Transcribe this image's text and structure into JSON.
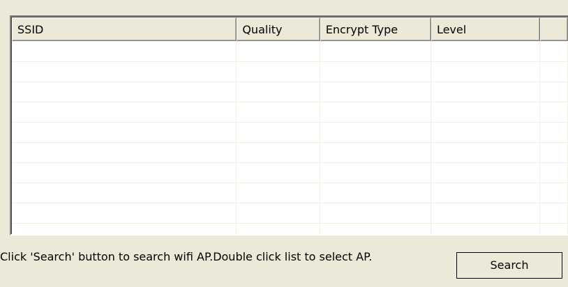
{
  "wifi_list": {
    "columns": [
      "SSID",
      "Quality",
      "Encrypt Type",
      "Level",
      ""
    ],
    "rows": [
      [
        "",
        "",
        "",
        "",
        ""
      ],
      [
        "",
        "",
        "",
        "",
        ""
      ],
      [
        "",
        "",
        "",
        "",
        ""
      ],
      [
        "",
        "",
        "",
        "",
        ""
      ],
      [
        "",
        "",
        "",
        "",
        ""
      ],
      [
        "",
        "",
        "",
        "",
        ""
      ],
      [
        "",
        "",
        "",
        "",
        ""
      ],
      [
        "",
        "",
        "",
        "",
        ""
      ],
      [
        "",
        "",
        "",
        "",
        ""
      ],
      [
        "",
        "",
        "",
        "",
        ""
      ]
    ]
  },
  "hint_text": "Click 'Search' button to search wifi AP.Double click list to select AP.",
  "search_button_label": "Search"
}
